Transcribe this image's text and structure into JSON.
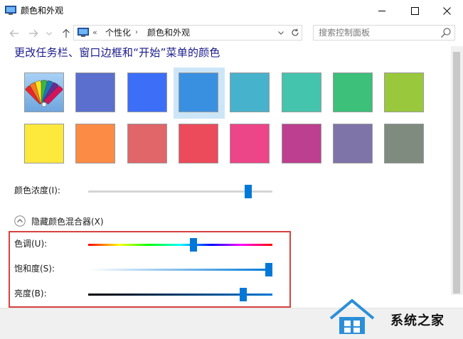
{
  "window": {
    "title": "颜色和外观",
    "icon": "display-color-icon",
    "buttons": {
      "minimize": "minimize-icon",
      "maximize": "maximize-icon",
      "close": "close-icon"
    }
  },
  "nav": {
    "back_icon": "back-arrow-icon",
    "forward_icon": "forward-arrow-icon",
    "recent_icon": "chevron-down-icon",
    "up_icon": "up-arrow-icon",
    "address": {
      "overflow": "«",
      "crumbs": [
        "个性化",
        "颜色和外观"
      ],
      "separator": "›"
    },
    "search": {
      "placeholder": "搜索控制面板",
      "value": ""
    }
  },
  "heading": "更改任务栏、窗口边框和“开始”菜单的颜色",
  "swatches": [
    {
      "type": "custom",
      "color": "#7fb3e8"
    },
    {
      "color": "#5b6fce"
    },
    {
      "color": "#3d6ef8"
    },
    {
      "color": "#3a90e0",
      "selected": true
    },
    {
      "color": "#47b2cc"
    },
    {
      "color": "#44c4ac"
    },
    {
      "color": "#3cc07a"
    },
    {
      "color": "#99c83c"
    },
    {
      "color": "#fde83c"
    },
    {
      "color": "#fb8b45"
    },
    {
      "color": "#e0666a"
    },
    {
      "color": "#eb4b5a"
    },
    {
      "color": "#ec4588"
    },
    {
      "color": "#bd3f8f"
    },
    {
      "color": "#7e74a8"
    },
    {
      "color": "#808b80"
    }
  ],
  "intensity": {
    "label": "颜色浓度(I):",
    "value": 0.87
  },
  "mixer": {
    "toggle_label": "隐藏颜色混合器(X)",
    "expanded": true,
    "hue": {
      "label": "色调(U):",
      "value": 0.57
    },
    "saturation": {
      "label": "饱和度(S):",
      "value": 0.98
    },
    "brightness": {
      "label": "亮度(B):",
      "value": 0.84
    }
  },
  "watermark": {
    "text": "系统之家"
  },
  "colors": {
    "accent": "#0078d7",
    "highlight_box": "#d9413f",
    "selected_bg": "#cde6f7"
  }
}
